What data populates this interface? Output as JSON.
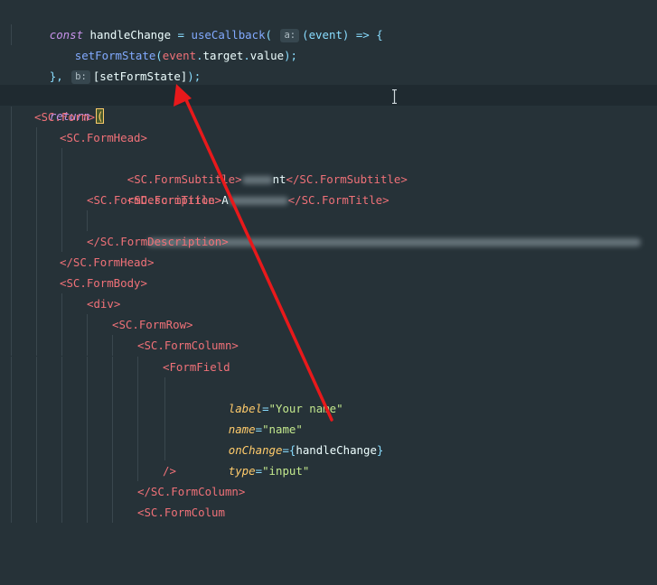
{
  "editor": {
    "lines": {
      "l1": {
        "kw": "const",
        "name": "handleChange",
        "eq": "=",
        "fn": "useCallback",
        "open": "(",
        "hint": "a:",
        "args": "(event)",
        "arrow": "=>",
        "brace": "{"
      },
      "l2": {
        "fn": "setFormState",
        "open": "(",
        "obj": "event",
        "dot1": ".",
        "prop1": "target",
        "dot2": ".",
        "prop2": "value",
        "close": ");"
      },
      "l3": {
        "close": "},",
        "hint": "b:",
        "deps": "[setFormState]",
        "end": ");"
      },
      "l4": {
        "semi": ";"
      },
      "l6": {
        "kw": "return",
        "paren": "("
      },
      "l7": {
        "tag": "<SC.Form>"
      },
      "l8": {
        "tag": "<SC.FormHead>"
      },
      "l9": {
        "open": "<SC.FormSubtitle>",
        "visible": "nt",
        "close": "</SC.FormSubtitle>"
      },
      "l10": {
        "open": "<SC.FormTitle>",
        "visible": "A",
        "close": "</SC.FormTitle>"
      },
      "l11": {
        "tag": "<SC.FormDescription>"
      },
      "l13": {
        "tag": "</SC.FormDescription>"
      },
      "l14": {
        "tag": "</SC.FormHead>"
      },
      "l15": {
        "tag": "<SC.FormBody>"
      },
      "l16": {
        "tag": "<div>"
      },
      "l17": {
        "tag": "<SC.FormRow>"
      },
      "l18": {
        "tag": "<SC.FormColumn>"
      },
      "l19": {
        "tag": "<FormField"
      },
      "l20": {
        "attr": "label",
        "eq": "=",
        "val": "\"Your name\""
      },
      "l21": {
        "attr": "name",
        "eq": "=",
        "val": "\"name\""
      },
      "l22": {
        "attr": "onChange",
        "eq": "=",
        "ob": "{",
        "val": "handleChange",
        "cb": "}"
      },
      "l23": {
        "attr": "type",
        "eq": "=",
        "val": "\"input\""
      },
      "l24": {
        "tag": "/>"
      },
      "l25": {
        "tag": "</SC.FormColumn>"
      },
      "l26": {
        "tag": "<SC.FormColum"
      }
    }
  },
  "colors": {
    "background": "#263238",
    "keyword": "#c792ea",
    "function": "#82aaff",
    "tag": "#f07178",
    "attribute": "#ffcb6b",
    "string": "#c3e88d",
    "annotation_arrow": "#e8191b"
  }
}
